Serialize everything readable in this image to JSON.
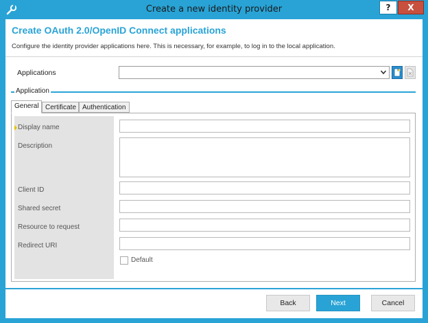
{
  "window": {
    "title": "Create a new identity provider",
    "help_label": "?",
    "close_label": "X"
  },
  "header": {
    "title": "Create OAuth 2.0/OpenID Connect applications",
    "description": "Configure the identity provider applications here. This is necessary, for example, to log in to the local application."
  },
  "applications": {
    "label": "Applications",
    "selected": ""
  },
  "group": {
    "title": "Application"
  },
  "tabs": [
    {
      "label": "General",
      "active": true
    },
    {
      "label": "Certificate",
      "active": false
    },
    {
      "label": "Authentication",
      "active": false
    }
  ],
  "form": {
    "display_name": {
      "label": "Display name",
      "value": ""
    },
    "description": {
      "label": "Description",
      "value": ""
    },
    "client_id": {
      "label": "Client ID",
      "value": ""
    },
    "shared_secret": {
      "label": "Shared secret",
      "value": ""
    },
    "resource": {
      "label": "Resource to request",
      "value": ""
    },
    "redirect_uri": {
      "label": "Redirect URI",
      "value": ""
    },
    "default": {
      "label": "Default",
      "checked": false
    }
  },
  "footer": {
    "back": "Back",
    "next": "Next",
    "cancel": "Cancel"
  },
  "colors": {
    "accent": "#29a3d6",
    "close": "#c7503f",
    "label_panel": "#e3e3e3"
  }
}
